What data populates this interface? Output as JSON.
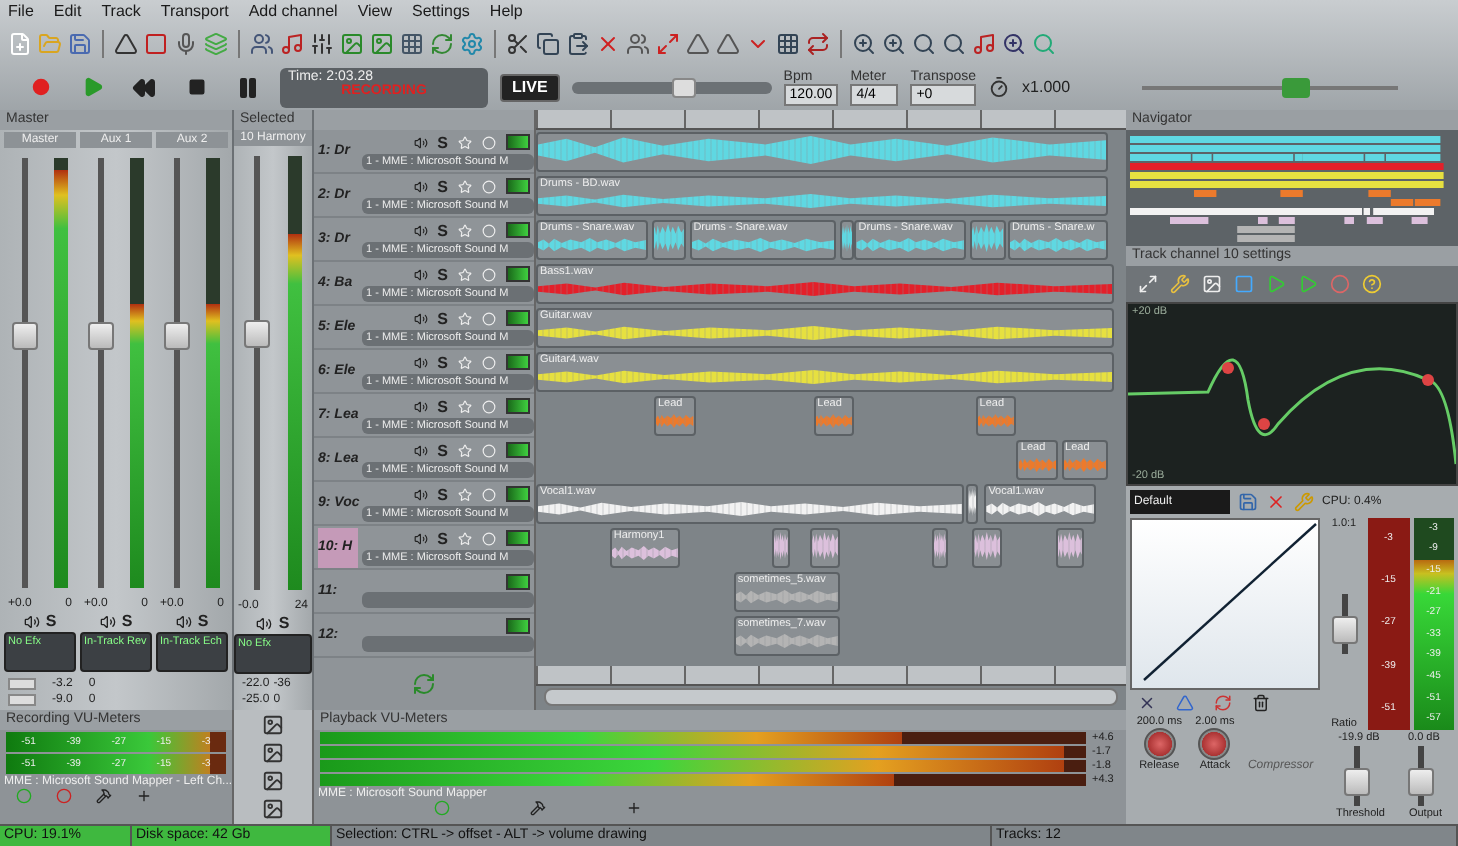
{
  "menu": [
    "File",
    "Edit",
    "Track",
    "Transport",
    "Add channel",
    "View",
    "Settings",
    "Help"
  ],
  "transport": {
    "time": "Time: 2:03.28",
    "status": "RECORDING",
    "live": "LIVE",
    "position": {
      "level": 0.56
    },
    "bpm_label": "Bpm",
    "bpm": "120.00",
    "meter_label": "Meter",
    "meter": "4/4",
    "transpose_label": "Transpose",
    "transpose": "+0",
    "speed": "x1.000",
    "zoom": {
      "level": 0.6
    }
  },
  "mixer": {
    "title": "Master",
    "channels": [
      {
        "name": "Master",
        "volume": "+0.0",
        "pan": "0",
        "level": 0.97,
        "solo_label": "S",
        "effect": "No Efx"
      },
      {
        "name": "Aux 1",
        "volume": "+0.0",
        "pan": "0",
        "level": 0.66,
        "solo_label": "S",
        "effect": "In-Track Rev"
      },
      {
        "name": "Aux 2",
        "volume": "+0.0",
        "pan": "0",
        "level": 0.66,
        "solo_label": "S",
        "effect": "In-Track Ech"
      }
    ],
    "sends": [
      {
        "value": "-3.2",
        "pan": "0"
      },
      {
        "value": "-9.0",
        "pan": "0"
      }
    ]
  },
  "selected_channel": {
    "title": "Selected",
    "name": "10 Harmony",
    "volume": "-0.0",
    "pan": "24",
    "level": 0.82,
    "solo_label": "S",
    "effect": "No Efx",
    "sends": [
      {
        "value": "-22.0",
        "pan": "-36"
      },
      {
        "value": "-25.0",
        "pan": "0"
      }
    ]
  },
  "tracks": [
    {
      "name": "1: Dr",
      "solo_label": "S",
      "device": "1 - MME : Microsoft Sound M",
      "selected": false,
      "color": "#5fd8e2",
      "clips": [
        {
          "kind": "audio"
        }
      ]
    },
    {
      "name": "2: Dr",
      "solo_label": "S",
      "device": "1 - MME : Microsoft Sound M",
      "selected": false,
      "color": "#5fd8e2",
      "clips": [
        {
          "kind": "audio",
          "name": "Drums - BD.wav"
        }
      ]
    },
    {
      "name": "3: Dr",
      "solo_label": "S",
      "device": "1 - MME : Microsoft Sound M",
      "selected": false,
      "color": "#5fd8e2",
      "clips": [
        {
          "kind": "audio",
          "name": "Drums - Snare.wav"
        },
        {
          "kind": "audio"
        },
        {
          "kind": "audio",
          "name": "Drums - Snare.wav"
        },
        {
          "kind": "audio"
        },
        {
          "kind": "audio",
          "name": "Drums - Snare.wav"
        },
        {
          "kind": "audio"
        },
        {
          "kind": "audio",
          "name": "Drums - Snare.w"
        }
      ]
    },
    {
      "name": "4: Ba",
      "solo_label": "S",
      "device": "1 - MME : Microsoft Sound M",
      "selected": false,
      "color": "#e3202a",
      "clips": [
        {
          "kind": "audio",
          "name": "Bass1.wav"
        }
      ]
    },
    {
      "name": "5: Ele",
      "solo_label": "S",
      "device": "1 - MME : Microsoft Sound M",
      "selected": false,
      "color": "#e6e040",
      "clips": [
        {
          "kind": "audio",
          "name": "Guitar.wav"
        }
      ]
    },
    {
      "name": "6: Ele",
      "solo_label": "S",
      "device": "1 - MME : Microsoft Sound M",
      "selected": false,
      "color": "#e6e040",
      "clips": [
        {
          "kind": "audio",
          "name": "Guitar4.wav"
        }
      ]
    },
    {
      "name": "7: Lea",
      "solo_label": "S",
      "device": "1 - MME : Microsoft Sound M",
      "selected": false,
      "color": "#ec7a2c",
      "clips": [
        {
          "kind": "audio",
          "name": "Lead"
        },
        {
          "kind": "audio",
          "name": "Lead"
        },
        {
          "kind": "audio",
          "name": "Lead"
        }
      ]
    },
    {
      "name": "8: Lea",
      "solo_label": "S",
      "device": "1 - MME : Microsoft Sound M",
      "selected": false,
      "color": "#ec7a2c",
      "clips": [
        {
          "kind": "audio",
          "name": "Lead"
        },
        {
          "kind": "audio",
          "name": "Lead"
        }
      ]
    },
    {
      "name": "9: Voc",
      "solo_label": "S",
      "device": "1 - MME : Microsoft Sound M",
      "selected": false,
      "color": "#f2f2f2",
      "clips": [
        {
          "kind": "audio",
          "name": "Vocal1.wav"
        },
        {
          "kind": "audio"
        },
        {
          "kind": "audio",
          "name": "Vocal1.wav"
        }
      ]
    },
    {
      "name": "10: H",
      "solo_label": "S",
      "device": "1 - MME : Microsoft Sound M",
      "selected": true,
      "color": "#dcc0dc",
      "clips": [
        {
          "kind": "audio",
          "name": "Harmony1"
        },
        {
          "kind": "audio"
        },
        {
          "kind": "audio"
        },
        {
          "kind": "audio"
        },
        {
          "kind": "audio"
        },
        {
          "kind": "audio"
        }
      ]
    },
    {
      "name": "11:",
      "selected": false,
      "color": "#b4b4b4",
      "clips": [
        {
          "kind": "audio",
          "name": "sometimes_5.wav"
        }
      ]
    },
    {
      "name": "12:",
      "selected": false,
      "color": "#b4b4b4",
      "clips": [
        {
          "kind": "audio",
          "name": "sometimes_7.wav"
        }
      ]
    }
  ],
  "navigator": {
    "title": "Navigator"
  },
  "track_settings": {
    "title": "Track channel 10 settings",
    "eq_top": "+20 dB",
    "eq_bottom": "-20 dB",
    "preset": "Default",
    "cpu": "CPU: 0.4%",
    "ratio_value": "1.0:1",
    "ratio_label": "Ratio",
    "threshold_value": "-19.9 dB",
    "output_value": "0.0 dB",
    "release": "200.0 ms",
    "attack": "2.00 ms",
    "release_label": "Release",
    "attack_label": "Attack",
    "compressor_label": "Compressor",
    "threshold_label": "Threshold",
    "output_label": "Output",
    "reduction_scale": [
      "-3",
      "-15",
      "-27",
      "-39",
      "-51"
    ],
    "output_scale": [
      "-3",
      "-9",
      "-15",
      "-21",
      "-27",
      "-33",
      "-39",
      "-45",
      "-51",
      "-57"
    ],
    "output_meter": {
      "level": 0.8
    }
  },
  "recording_vu": {
    "title": "Recording VU-Meters",
    "meters": [
      {
        "level": 0.93,
        "scale": [
          "-51",
          "-39",
          "-27",
          "-15",
          "-3"
        ]
      },
      {
        "level": 0.93,
        "scale": [
          "-51",
          "-39",
          "-27",
          "-15",
          "-3"
        ]
      }
    ],
    "device": "MME : Microsoft Sound Mapper - Left Ch..."
  },
  "playback_vu": {
    "title": "Playback VU-Meters",
    "meters": [
      {
        "level": 0.76,
        "reading": "+4.6"
      },
      {
        "level": 0.97,
        "reading": "-1.7"
      },
      {
        "level": 0.97,
        "reading": "-1.8"
      },
      {
        "level": 0.75,
        "reading": "+4.3"
      }
    ],
    "device": "MME : Microsoft Sound Mapper"
  },
  "status_bar": [
    "CPU: 19.1%",
    "Disk space: 42 Gb",
    "Selection: CTRL -> offset - ALT -> volume drawing",
    "Tracks: 12"
  ]
}
